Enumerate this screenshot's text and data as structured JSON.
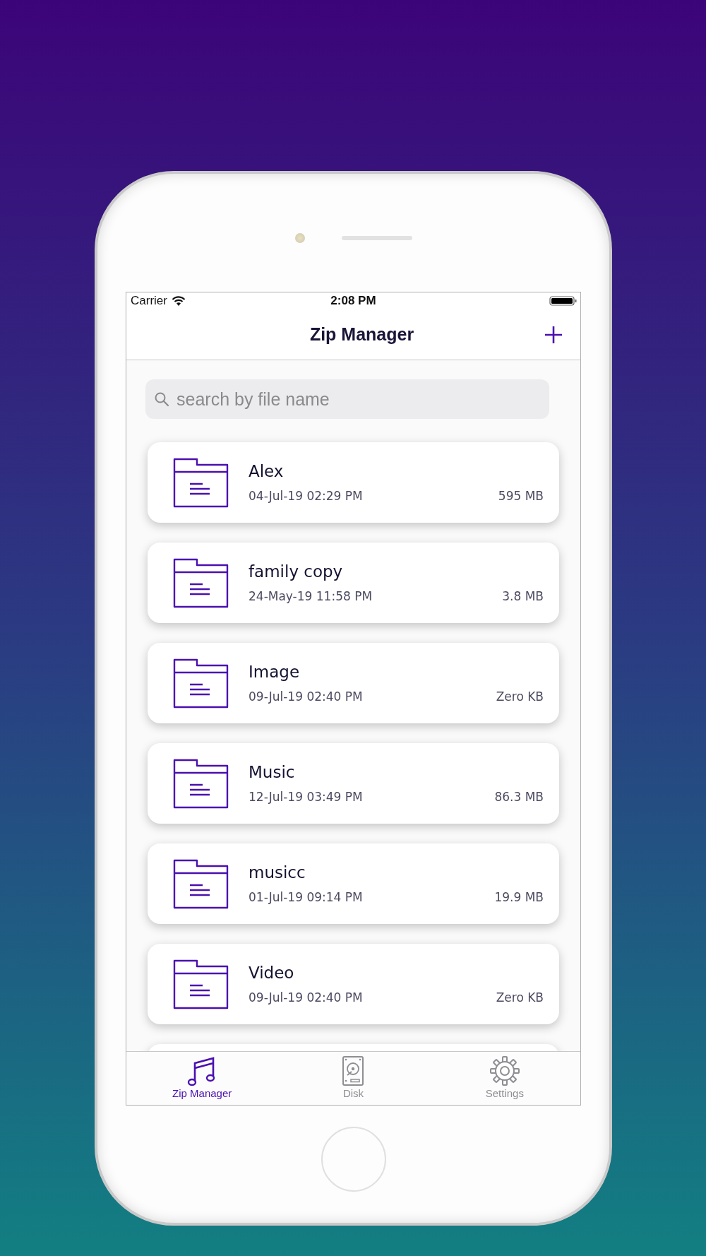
{
  "status_bar": {
    "carrier": "Carrier",
    "time": "2:08 PM"
  },
  "nav_bar": {
    "title": "Zip Manager"
  },
  "search": {
    "placeholder": "search by file name"
  },
  "files": [
    {
      "name": "Alex",
      "date": "04-Jul-19 02:29 PM",
      "size": "595 MB"
    },
    {
      "name": "family copy",
      "date": "24-May-19 11:58 PM",
      "size": "3.8 MB"
    },
    {
      "name": "Image",
      "date": "09-Jul-19 02:40 PM",
      "size": "Zero KB"
    },
    {
      "name": "Music",
      "date": "12-Jul-19 03:49 PM",
      "size": "86.3 MB"
    },
    {
      "name": "musicc",
      "date": "01-Jul-19 09:14 PM",
      "size": "19.9 MB"
    },
    {
      "name": "Video",
      "date": "09-Jul-19 02:40 PM",
      "size": "Zero KB"
    }
  ],
  "tabs": [
    {
      "kind": "music",
      "label": "Zip Manager",
      "selected": true
    },
    {
      "kind": "disk",
      "label": "Disk",
      "selected": false
    },
    {
      "kind": "settings",
      "label": "Settings",
      "selected": false
    }
  ]
}
